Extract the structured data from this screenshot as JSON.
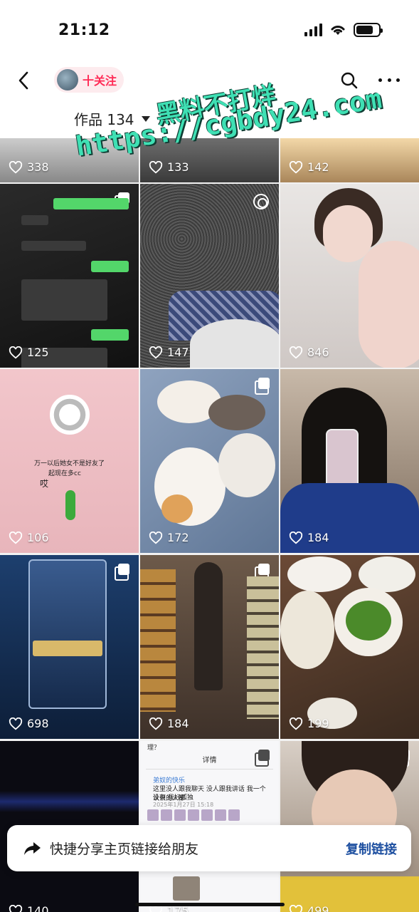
{
  "status_bar": {
    "time": "21:12"
  },
  "nav": {
    "follow_label": "十关注"
  },
  "tab": {
    "label": "作品 134"
  },
  "watermark": {
    "line1": "黑料不打烊",
    "line2": "https://cgbdy24.com"
  },
  "grid": {
    "likes": [
      "338",
      "133",
      "142",
      "125",
      "147",
      "846",
      "106",
      "172",
      "184",
      "698",
      "184",
      "199",
      "140",
      "175",
      "499"
    ],
    "pink_tile_text": [
      "万一以后她女不是好友了",
      "起现在多cc",
      "哎"
    ],
    "doc_tile": {
      "header": "详情",
      "top_text": "理？",
      "user": "弟奴的快乐",
      "line1": "这里没人跟我聊天 没人跟我讲话 我一个认识的人都",
      "line2": "没有 我好孤独",
      "date": "2025年1月27日 15:18"
    }
  },
  "share_banner": {
    "text": "快捷分享主页链接给朋友",
    "action": "复制链接"
  },
  "colors": {
    "accent": "#ff2a55",
    "link": "#1d4fa0",
    "watermark": "#3fe0b4"
  }
}
